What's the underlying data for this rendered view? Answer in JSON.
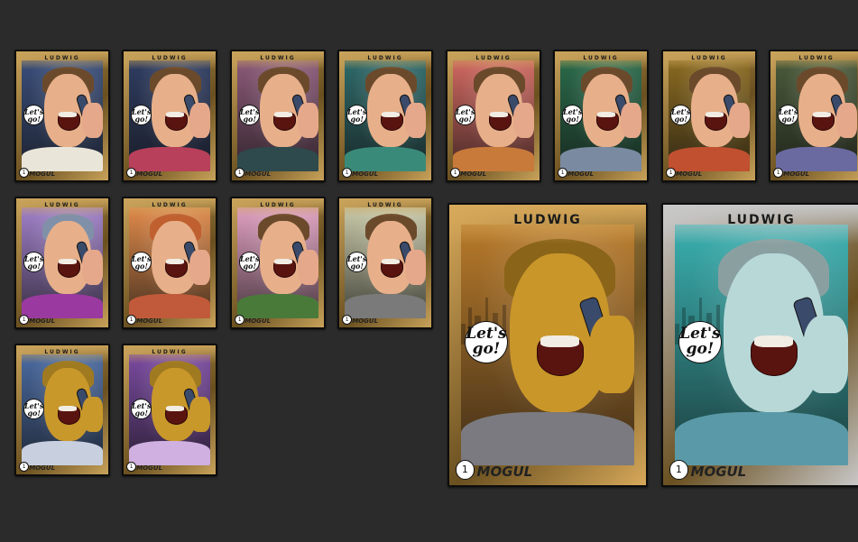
{
  "card_text": {
    "title": "LUDWIG",
    "speech": "Let's go!",
    "brand": "MOGUL",
    "number": "1"
  },
  "cards": [
    {
      "id": "r1c0",
      "bg": "#3a4e7a",
      "frame": "#c8a25a",
      "skin": "#e7b08a",
      "hair": "#6b4a2c",
      "sweater": "#e9e5d8",
      "hand": "#e6a88a"
    },
    {
      "id": "r1c1",
      "bg": "#2f3d62",
      "frame": "#c8a25a",
      "skin": "#e7b08a",
      "hair": "#6b4a2c",
      "sweater": "#b8405a",
      "hand": "#e6a88a"
    },
    {
      "id": "r1c2",
      "bg": "#8b5a78",
      "frame": "#c8a25a",
      "skin": "#e7b08a",
      "hair": "#6b4a2c",
      "sweater": "#2e4a4c",
      "hand": "#e6a88a"
    },
    {
      "id": "r1c3",
      "bg": "#2f6a6a",
      "frame": "#c8a25a",
      "skin": "#e7b08a",
      "hair": "#6b4a2c",
      "sweater": "#3a8a7a",
      "hand": "#e6a88a"
    },
    {
      "id": "r1c4",
      "bg": "#d06860",
      "frame": "#c8a25a",
      "skin": "#e7b08a",
      "hair": "#6b4a2c",
      "sweater": "#c87a3a",
      "hand": "#e6a88a"
    },
    {
      "id": "r1c5",
      "bg": "#2a6a4a",
      "frame": "#c8a25a",
      "skin": "#e7b08a",
      "hair": "#6b4a2c",
      "sweater": "#7a8aa0",
      "hand": "#e6a88a"
    },
    {
      "id": "r1c6",
      "bg": "#8a6a20",
      "frame": "#c8a25a",
      "skin": "#e7b08a",
      "hair": "#6b4a2c",
      "sweater": "#c05030",
      "hand": "#e6a88a"
    },
    {
      "id": "r1c7",
      "bg": "#4a5a3a",
      "frame": "#c8a25a",
      "skin": "#e7b08a",
      "hair": "#6b4a2c",
      "sweater": "#6a6aa0",
      "hand": "#e6a88a"
    },
    {
      "id": "r2c0",
      "bg": "#a080c8",
      "frame": "#c8a25a",
      "skin": "#e7b08a",
      "hair": "#8090a8",
      "sweater": "#9a3aa0",
      "hand": "#e6a88a"
    },
    {
      "id": "r2c1",
      "bg": "#e08a4a",
      "frame": "#c8a25a",
      "skin": "#e7b08a",
      "hair": "#c06030",
      "sweater": "#c05a3a",
      "hand": "#e6a88a"
    },
    {
      "id": "r2c2",
      "bg": "#e0a0c0",
      "frame": "#c8a25a",
      "skin": "#e7b08a",
      "hair": "#6b4a2c",
      "sweater": "#4a7a3a",
      "hand": "#e6a88a"
    },
    {
      "id": "r2c3",
      "bg": "#c8c8a8",
      "frame": "#c8a25a",
      "skin": "#e7b08a",
      "hair": "#6b4a2c",
      "sweater": "#7a7a7a",
      "hand": "#e6a88a"
    },
    {
      "id": "r3c0",
      "bg": "#4a6aa0",
      "frame": "#c8a25a",
      "skin": "#c9982a",
      "hair": "#a07a20",
      "sweater": "#c8d0e0",
      "hand": "#c9982a"
    },
    {
      "id": "r3c1",
      "bg": "#7a4aa0",
      "frame": "#c8a25a",
      "skin": "#c9982a",
      "hair": "#a07a20",
      "sweater": "#d0b0e0",
      "hand": "#c9982a"
    },
    {
      "id": "big-gold",
      "bg": "#b87a2a",
      "frame": "#d6a85a",
      "skin": "#c9962a",
      "hair": "#8a6418",
      "sweater": "#7a7a80",
      "hand": "#c9962a"
    },
    {
      "id": "big-silver",
      "bg": "#3ab0b0",
      "frame": "#c8c8c8",
      "skin": "#b8d8d8",
      "hair": "#8aa0a0",
      "sweater": "#5a9aa8",
      "hand": "#b8d8d8"
    }
  ]
}
